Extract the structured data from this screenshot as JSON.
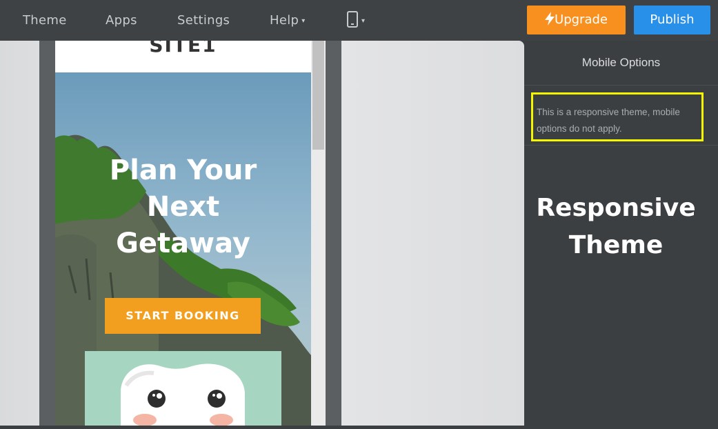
{
  "nav": {
    "items": [
      {
        "label": "Theme"
      },
      {
        "label": "Apps"
      },
      {
        "label": "Settings"
      },
      {
        "label": "Help"
      }
    ],
    "upgrade_label": "Upgrade",
    "publish_label": "Publish"
  },
  "colors": {
    "topbar": "#3e4245",
    "upgrade": "#f7901e",
    "publish": "#2990ea",
    "highlight": "#f6f600",
    "booking_button": "#f29f1f"
  },
  "preview": {
    "site_title": "SITE1",
    "hero_heading": [
      "Plan Your",
      "Next",
      "Getaway"
    ],
    "booking_label": "START BOOKING"
  },
  "panel": {
    "title": "Mobile Options",
    "note": "This is a responsive theme, mobile options do not apply."
  },
  "annotation": [
    "Responsive",
    "Theme"
  ],
  "icons": {
    "device": "mobile-device-icon",
    "upgrade": "lightning-bolt-icon"
  }
}
